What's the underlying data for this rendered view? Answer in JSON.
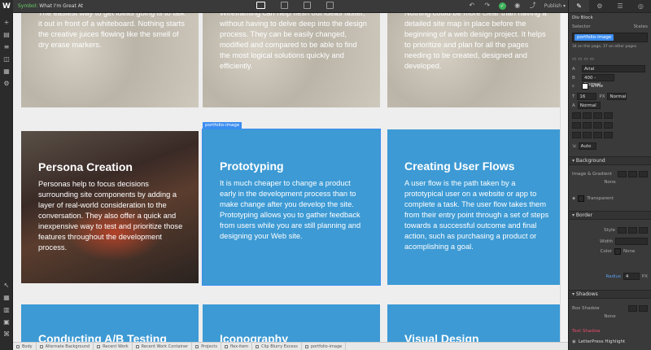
{
  "topbar": {
    "logo": "W",
    "symbol_prefix": "Symbol:",
    "symbol_name": "What I'm Great At",
    "publish_label": "Publish ▾"
  },
  "cards_top": [
    {
      "text": "The easiest way to get ideas going is to talk it out in front of a whiteboard. Nothing starts the creative juices flowing like the smell of dry erase markers."
    },
    {
      "text": "Wireframing can help flesh out ideas faster, without having to delve deep into the design process. They can be easily changed, modified and compared to be able to find the most logical solutions quickly and efficiently."
    },
    {
      "text": "Nothing could be more clear than having a detailed site map in place before the beginning of a web design project. It helps to prioritize and plan for all the pages needing to be created, designed and developed."
    }
  ],
  "cards_mid": [
    {
      "title": "Persona Creation",
      "text": "Personas help to focus decisions surrounding site components by adding a layer of real-world consideration to the conversation. They also offer a quick and inexpensive way to test and prioritize those features throughout the development process."
    },
    {
      "title": "Prototyping",
      "text": "It is much cheaper to change a product early in the development process than to make change after you develop the site. Prototyping allows you to gather feedback from users while you are still planning and designing your Web site."
    },
    {
      "title": "Creating User Flows",
      "text": "A user flow is the path taken by a prototypical user on a website or app to complete a task. The user flow takes them from their entry point through a set of steps towards a successful outcome and final action, such as purchasing a product or acomplishing a goal."
    }
  ],
  "cards_bottom": [
    {
      "title": "Conducting A/B Testing"
    },
    {
      "title": "Iconography"
    },
    {
      "title": "Visual Design"
    }
  ],
  "selection_tag": "portfolio-image",
  "breadcrumbs": [
    "Body",
    "Alternate Background",
    "Recent Work",
    "Recent Work Container",
    "Projects",
    "flex-item",
    "Clip Blurry Excess",
    "portfolio-image"
  ],
  "panel": {
    "element_type": "Div Block",
    "selector_label": "Selector",
    "states_label": "States",
    "selector_value": "portfolio-image",
    "usage_note": "34 on this page, 37 on other pages",
    "font": "Arial",
    "weight": "400 - Normal",
    "color_name": "white",
    "size_value": "16",
    "size_unit": "PX",
    "line_height_value": "Normal",
    "letter_value": "Normal",
    "auto_label": "Auto",
    "background_label": "Background",
    "image_gradient_label": "Image & Gradient",
    "none_label": "None",
    "transparent_label": "Transparent",
    "border_label": "Border",
    "style_label": "Style",
    "width_label": "Width",
    "color_label": "Color",
    "none_label2": "None",
    "radius_label": "Radius",
    "radius_value": "4",
    "radius_unit": "PX",
    "shadows_label": "Shadows",
    "box_shadow_label": "Box Shadow",
    "text_shadow_label": "Text Shadow",
    "none_label3": "None",
    "bottom_item": "LetterPress Highlight"
  }
}
